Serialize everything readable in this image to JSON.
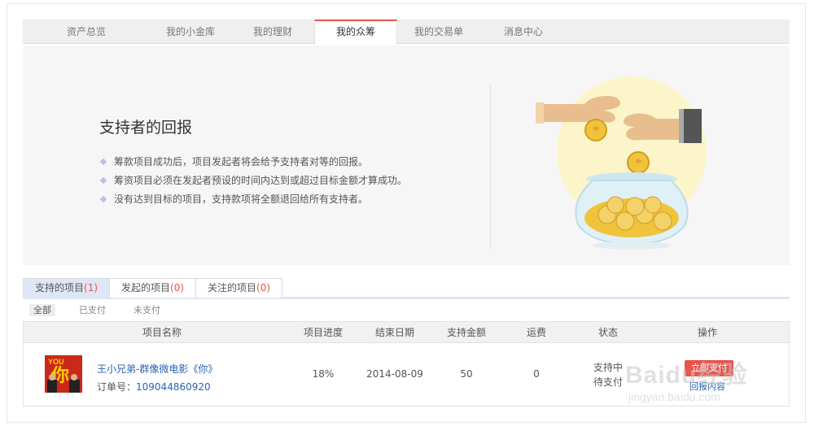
{
  "top_tabs": [
    {
      "label": "资产总览",
      "active": false
    },
    {
      "label": "我的小金库",
      "active": false
    },
    {
      "label": "我的理财",
      "active": false
    },
    {
      "label": "我的众筹",
      "active": true
    },
    {
      "label": "我的交易单",
      "active": false
    },
    {
      "label": "消息中心",
      "active": false
    }
  ],
  "hero": {
    "title": "支持者的回报",
    "bullets": [
      "筹款项目成功后，项目发起者将会给予支持者对等的回报。",
      "筹资项目必须在发起者预设的时间内达到或超过目标金额才算成功。",
      "没有达到目标的项目，支持款项将全额退回给所有支持者。"
    ],
    "illustration": "hands-coins-jar-illustration"
  },
  "sub_tabs": [
    {
      "label": "支持的项目",
      "count": "(1)",
      "active": true
    },
    {
      "label": "发起的项目",
      "count": "(0)",
      "active": false
    },
    {
      "label": "关注的项目",
      "count": "(0)",
      "active": false
    }
  ],
  "filters": [
    {
      "label": "全部",
      "active": true
    },
    {
      "label": "已支付",
      "active": false
    },
    {
      "label": "未支付",
      "active": false
    }
  ],
  "table": {
    "headers": [
      "项目名称",
      "项目进度",
      "结束日期",
      "支持金额",
      "运费",
      "状态",
      "操作"
    ],
    "rows": [
      {
        "thumb_text_top": "YOU",
        "thumb_text_main": "你",
        "name": "王小兄弟-群像微电影《你》",
        "order_label": "订单号：",
        "order_no": "109044860920",
        "progress": "18%",
        "end_date": "2014-08-09",
        "amount": "50",
        "shipping": "0",
        "status_1": "支持中",
        "status_2": "待支付",
        "op_button": "立即支付",
        "op_link": "回报内容"
      }
    ]
  },
  "watermark": {
    "text": "Baidu经验",
    "url": "jingyan.baidu.com"
  },
  "colors": {
    "accent": "#e8554e",
    "link": "#2a62b0",
    "tab_bg": "#efefef",
    "hero_bg": "#f6f6f6",
    "subtab_active": "#dfe6f6"
  }
}
